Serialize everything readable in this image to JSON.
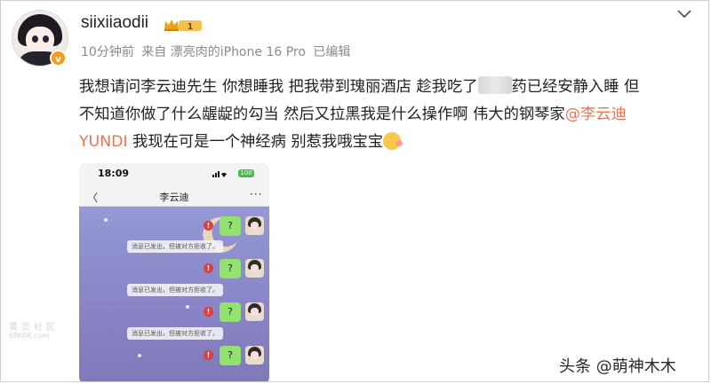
{
  "post": {
    "username": "siixiiaodii",
    "level_badge": "1",
    "verified_badge": "v",
    "meta": {
      "time": "10分钟前",
      "source": "来自 漂亮肉的iPhone 16 Pro",
      "edited": "已编辑"
    },
    "text": {
      "line1_a": "我想请问李云迪先生 你想睡我 把我带到瑰丽酒店 趁我吃了",
      "line1_b": "药已经安静入睡 但",
      "line2": "不知道你做了什么龌龊的勾当 然后又拉黑我是什么操作啊 伟大的钢琴家",
      "mention_a": "@李云迪",
      "mention_b": "YUNDI",
      "line3": " 我现在可是一个神经病 别惹我哦宝宝"
    }
  },
  "screenshot": {
    "time": "18:09",
    "battery": "100",
    "chat_title": "李云迪",
    "back_label": "〈",
    "more_label": "···",
    "error_mark": "!",
    "messages": [
      {
        "bubble": "?",
        "system": "消息已发出，但被对方拒收了。"
      },
      {
        "bubble": "?",
        "system": "消息已发出，但被对方拒收了。"
      },
      {
        "bubble": "?",
        "system": "消息已发出，但被对方拒收了。"
      },
      {
        "bubble": "?",
        "system": ""
      }
    ]
  },
  "watermark": {
    "line1": "黄页社区",
    "line2": "6PARK.com"
  },
  "credit": "头条 @萌神木木",
  "colors": {
    "mention": "#eb7350",
    "bubble": "#93e270",
    "error": "#e73a3a",
    "verified": "#f59a1b"
  }
}
